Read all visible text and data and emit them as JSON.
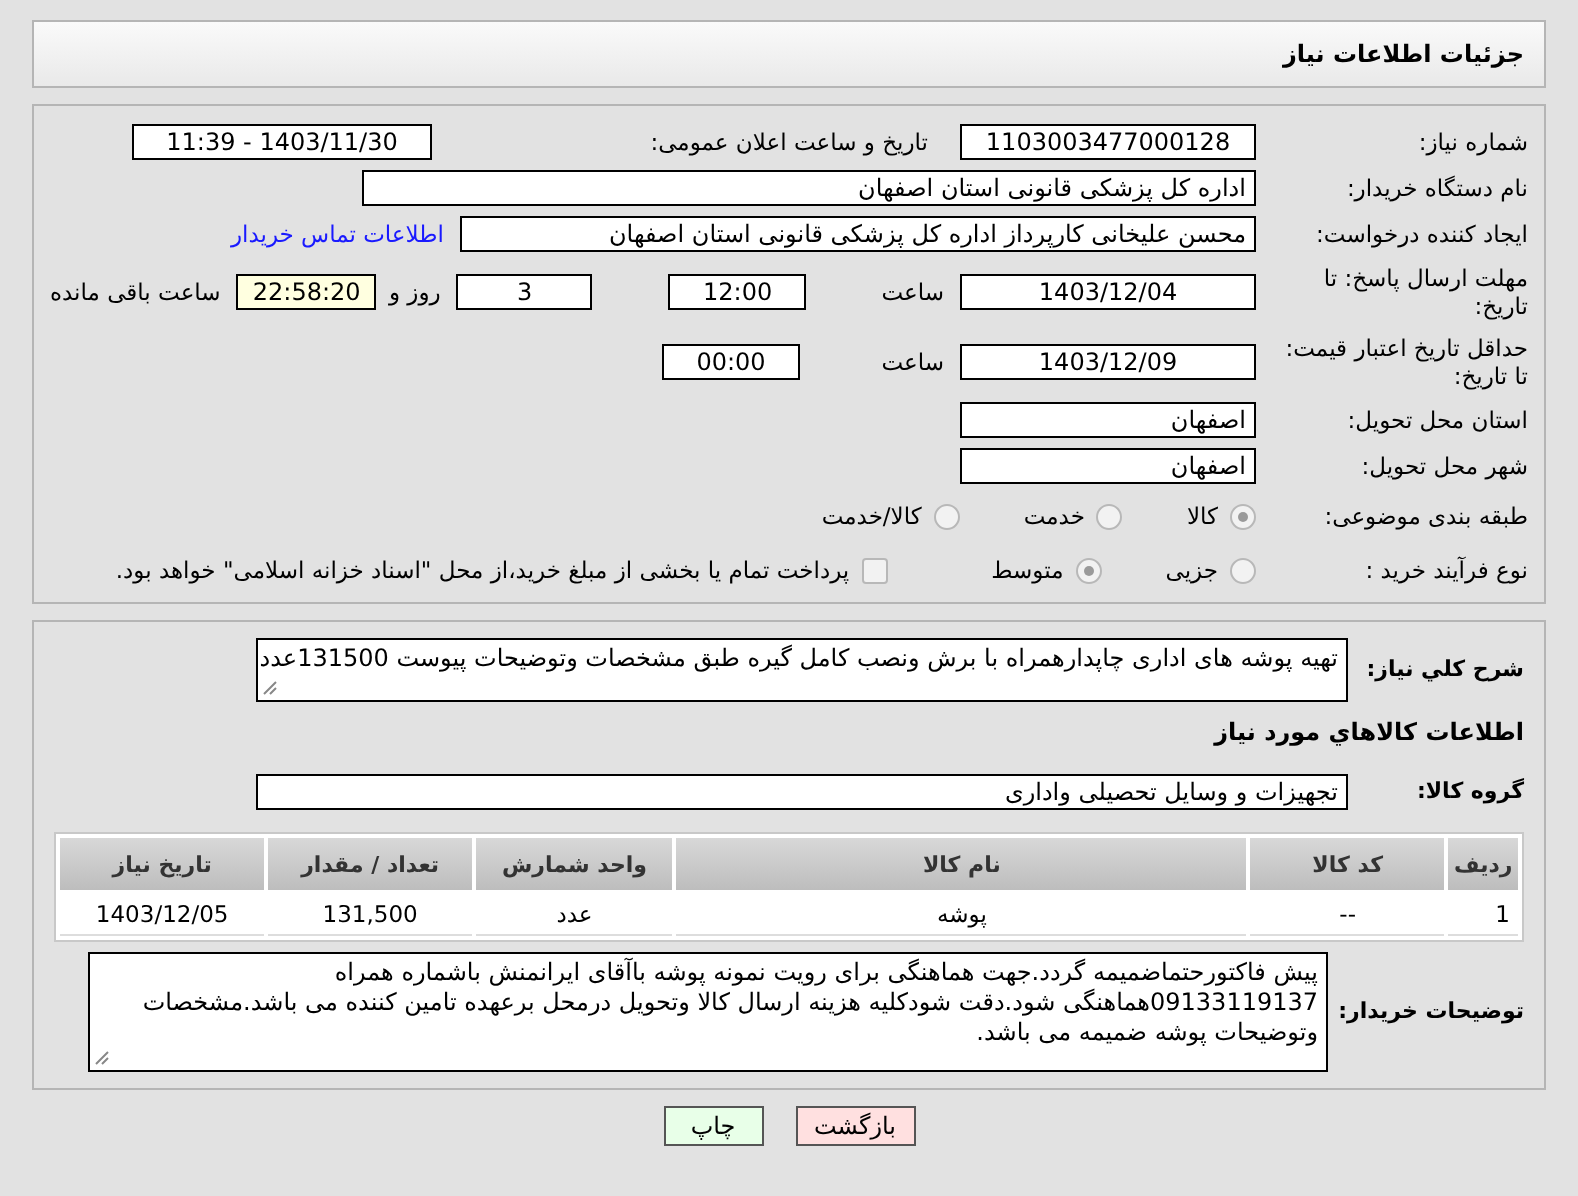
{
  "header": {
    "title": "جزئیات اطلاعات نیاز"
  },
  "need_number": {
    "label": "شماره نیاز:",
    "value": "1103003477000128"
  },
  "announce": {
    "label": "تاریخ و ساعت اعلان عمومی:",
    "value": "1403/11/30 - 11:39"
  },
  "buyer_org": {
    "label": "نام دستگاه خریدار:",
    "value": "اداره کل پزشکی قانونی استان اصفهان"
  },
  "requester": {
    "label": "ایجاد کننده درخواست:",
    "value": "محسن علیخانی کارپرداز اداره کل پزشکی قانونی استان اصفهان",
    "link": "اطلاعات تماس خریدار"
  },
  "reply_deadline": {
    "label": "مهلت ارسال پاسخ: تا تاریخ:",
    "date": "1403/12/04",
    "time_label": "ساعت",
    "time": "12:00",
    "days": "3",
    "days_label": "روز و",
    "remaining": "22:58:20",
    "remaining_label": "ساعت باقی مانده"
  },
  "price_validity": {
    "label": "حداقل تاریخ اعتبار قیمت: تا تاریخ:",
    "date": "1403/12/09",
    "time_label": "ساعت",
    "time": "00:00"
  },
  "province": {
    "label": "استان محل تحویل:",
    "value": "اصفهان"
  },
  "city": {
    "label": "شهر محل تحویل:",
    "value": "اصفهان"
  },
  "category": {
    "label": "طبقه بندی موضوعی:",
    "options": [
      {
        "label": "کالا",
        "selected": true
      },
      {
        "label": "خدمت",
        "selected": false
      },
      {
        "label": "کالا/خدمت",
        "selected": false
      }
    ]
  },
  "purchase_type": {
    "label": "نوع فرآیند خرید :",
    "options": [
      {
        "label": "جزیی",
        "selected": false
      },
      {
        "label": "متوسط",
        "selected": true
      }
    ],
    "payment": {
      "label": "پرداخت تمام یا بخشی از مبلغ خرید،از محل \"اسناد خزانه اسلامی\" خواهد بود.",
      "checked": false
    }
  },
  "summary": {
    "label": "شرح کلي نياز:",
    "value": "تهیه پوشه های اداری چاپدارهمراه با برش ونصب کامل گیره طبق مشخصات وتوضیحات پیوست 131500عدد"
  },
  "goods_heading": "اطلاعات کالاهاي مورد نياز",
  "goods_group": {
    "label": "گروه کالا:",
    "value": "تجهیزات و وسایل تحصیلی واداری"
  },
  "table": {
    "columns": [
      "ردیف",
      "کد کالا",
      "نام کالا",
      "واحد شمارش",
      "تعداد / مقدار",
      "تاریخ نیاز"
    ],
    "rows": [
      [
        "1",
        "--",
        "پوشه",
        "عدد",
        "131,500",
        "1403/12/05"
      ]
    ]
  },
  "buyer_notes": {
    "label": "توضیحات خریدار:",
    "value": "پیش فاکتورحتماضمیمه گردد.جهت هماهنگی برای رویت نمونه پوشه باآقای ایرانمنش باشماره همراه 09133119137هماهنگی شود.دقت شودکلیه هزینه ارسال کالا وتحویل درمحل برعهده تامین کننده می باشد.مشخصات وتوضیحات پوشه ضمیمه می باشد."
  },
  "buttons": [
    {
      "label": "بازگشت",
      "kind": "back"
    },
    {
      "label": "چاپ",
      "kind": "print"
    }
  ]
}
